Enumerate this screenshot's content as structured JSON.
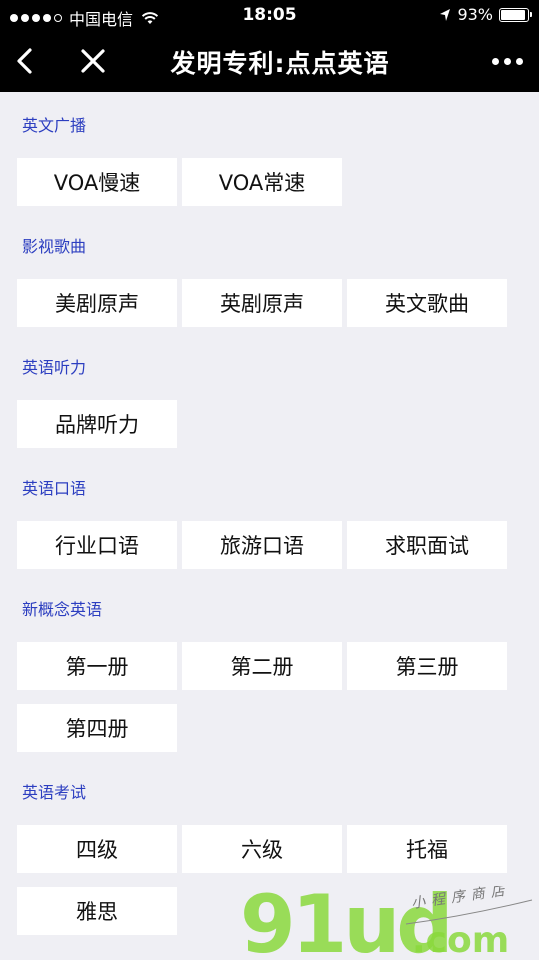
{
  "status_bar": {
    "carrier": "中国电信",
    "time": "18:05",
    "battery_text": "93%",
    "battery_level": 0.93
  },
  "nav": {
    "title": "发明专利:点点英语"
  },
  "sections": [
    {
      "title": "英文广播",
      "items": [
        "VOA慢速",
        "VOA常速"
      ]
    },
    {
      "title": "影视歌曲",
      "items": [
        "美剧原声",
        "英剧原声",
        "英文歌曲"
      ]
    },
    {
      "title": "英语听力",
      "items": [
        "品牌听力"
      ]
    },
    {
      "title": "英语口语",
      "items": [
        "行业口语",
        "旅游口语",
        "求职面试"
      ]
    },
    {
      "title": "新概念英语",
      "items": [
        "第一册",
        "第二册",
        "第三册",
        "第四册"
      ]
    },
    {
      "title": "英语考试",
      "items": [
        "四级",
        "六级",
        "托福",
        "雅思"
      ]
    }
  ],
  "watermark": {
    "brand": "91ud",
    "domain": ".com",
    "tagline": "小程序商店"
  },
  "colors": {
    "section_title": "#2c3ec0",
    "background": "#efeff4",
    "bar": "#000000",
    "watermark_green": "#8ad83c"
  }
}
